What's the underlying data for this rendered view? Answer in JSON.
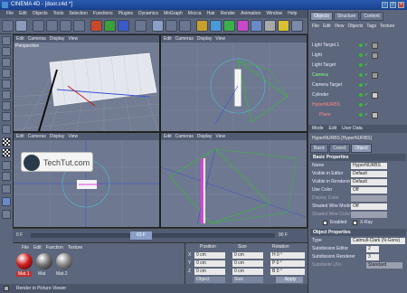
{
  "title": "CINEMA 4D - [door.c4d *]",
  "menu": [
    "File",
    "Edit",
    "Objects",
    "Tools",
    "Selection",
    "Functions",
    "Plugins",
    "Dynamics",
    "MoGraph",
    "Mocca",
    "Hair",
    "Render",
    "Animation",
    "Window",
    "Help"
  ],
  "viewport_menu": [
    "Edit",
    "Cameras",
    "Display",
    "View"
  ],
  "viewports": [
    {
      "label": "Perspective"
    },
    {
      "label": ""
    },
    {
      "label": ""
    },
    {
      "label": ""
    }
  ],
  "timeline": {
    "start": "0 F",
    "current": "63 F",
    "end": "90 F"
  },
  "materials": {
    "menu": [
      "File",
      "Edit",
      "Function",
      "Texture"
    ],
    "items": [
      "Mat.1",
      "Mat",
      "Mat.2"
    ]
  },
  "coords": {
    "headers": [
      "Position",
      "Size",
      "Rotation"
    ],
    "rows": [
      {
        "axis": "X",
        "pos": "0 cm",
        "size": "0 cm",
        "rot": "H 0 °"
      },
      {
        "axis": "Y",
        "pos": "0 cm",
        "size": "0 cm",
        "rot": "P 0 °"
      },
      {
        "axis": "Z",
        "pos": "0 cm",
        "size": "0 cm",
        "rot": "B 0 °"
      }
    ],
    "mode": "Object",
    "size_mode": "Size",
    "apply": "Apply"
  },
  "status": "Render in Picture Viewer",
  "logo": "TechTut.com",
  "objects": {
    "tabs": [
      "Objects",
      "Structure",
      "Content"
    ],
    "menu": [
      "File",
      "Edit",
      "View",
      "Objects",
      "Tags",
      "Texture"
    ],
    "items": [
      {
        "name": "Light Target.1",
        "color": "#eef"
      },
      {
        "name": "Light",
        "color": "#eef"
      },
      {
        "name": "Light Target",
        "color": "#eef"
      },
      {
        "name": "Camera",
        "color": "#8f8"
      },
      {
        "name": "Camera Target",
        "color": "#eef"
      },
      {
        "name": "Cylinder",
        "color": "#eef"
      },
      {
        "name": "HyperNURBS",
        "color": "#f88"
      },
      {
        "name": "Plane",
        "color": "#f88"
      }
    ]
  },
  "attributes": {
    "menu": [
      "Mode",
      "Edit",
      "User Data"
    ],
    "header": "HyperNURBS [HyperNURBS]",
    "tabs": [
      "Basic",
      "Coord.",
      "Object"
    ],
    "basic_title": "Basic Properties",
    "basic": [
      {
        "label": "Name",
        "value": "HyperNURBS"
      },
      {
        "label": "Visible in Editor",
        "value": "Default"
      },
      {
        "label": "Visible in Renderer",
        "value": "Default"
      },
      {
        "label": "Use Color",
        "value": "Off"
      },
      {
        "label": "Display Color",
        "value": ""
      },
      {
        "label": "Shaded Wire Mode",
        "value": "Off"
      },
      {
        "label": "Shaded Wire Color",
        "value": ""
      },
      {
        "label": "Enabled",
        "value": "X-Ray"
      }
    ],
    "object_title": "Object Properties",
    "object": [
      {
        "label": "Type",
        "value": "Catmull-Clark (N-Gons)"
      },
      {
        "label": "Subdivision Editor",
        "value": "2"
      },
      {
        "label": "Subdivision Renderer",
        "value": "3"
      },
      {
        "label": "Subdivide UVs",
        "value": "Standard"
      }
    ]
  },
  "colors": {
    "accent": "#2a5ab0",
    "viewport_bg": "#6e7890",
    "panel": "#5c667c",
    "selection": "#e040e0",
    "camera": "#30c030"
  }
}
